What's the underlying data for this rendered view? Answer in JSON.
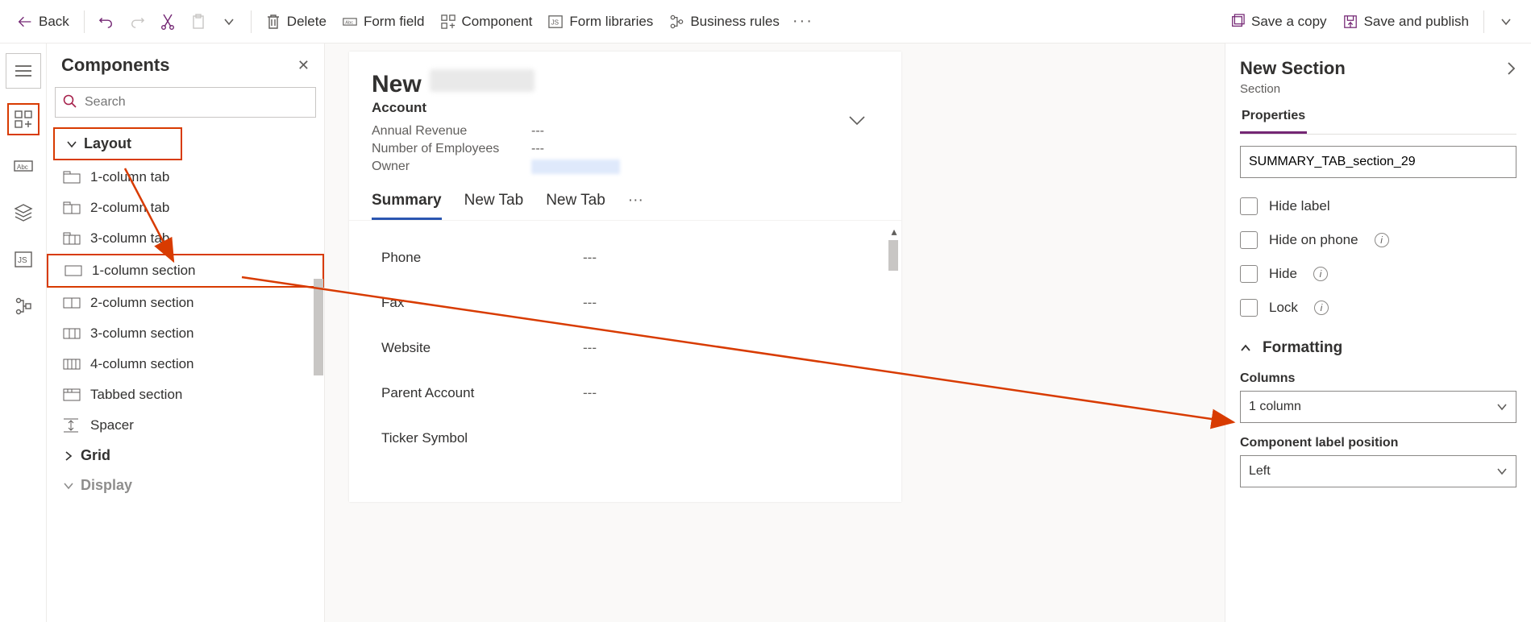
{
  "toolbar": {
    "back": "Back",
    "delete": "Delete",
    "form_field": "Form field",
    "component": "Component",
    "form_libraries": "Form libraries",
    "business_rules": "Business rules",
    "save_copy": "Save a copy",
    "save_publish": "Save and publish"
  },
  "components": {
    "title": "Components",
    "search_placeholder": "Search",
    "groups": {
      "layout": "Layout",
      "grid": "Grid",
      "display": "Display"
    },
    "layout_items": [
      "1-column tab",
      "2-column tab",
      "3-column tab",
      "1-column section",
      "2-column section",
      "3-column section",
      "4-column section",
      "Tabbed section",
      "Spacer"
    ]
  },
  "form": {
    "title_new": "New",
    "entity": "Account",
    "header_fields": [
      {
        "label": "Annual Revenue",
        "value": "---"
      },
      {
        "label": "Number of Employees",
        "value": "---"
      },
      {
        "label": "Owner",
        "value": ""
      }
    ],
    "tabs": [
      "Summary",
      "New Tab",
      "New Tab"
    ],
    "body_fields": [
      {
        "label": "Phone",
        "value": "---"
      },
      {
        "label": "Fax",
        "value": "---"
      },
      {
        "label": "Website",
        "value": "---"
      },
      {
        "label": "Parent Account",
        "value": "---"
      },
      {
        "label": "Ticker Symbol",
        "value": ""
      }
    ]
  },
  "props": {
    "title": "New Section",
    "subtitle": "Section",
    "tab": "Properties",
    "name_value": "SUMMARY_TAB_section_29",
    "checks": {
      "hide_label": "Hide label",
      "hide_phone": "Hide on phone",
      "hide": "Hide",
      "lock": "Lock"
    },
    "formatting": "Formatting",
    "columns_label": "Columns",
    "columns_value": "1 column",
    "label_pos_label": "Component label position",
    "label_pos_value": "Left"
  }
}
